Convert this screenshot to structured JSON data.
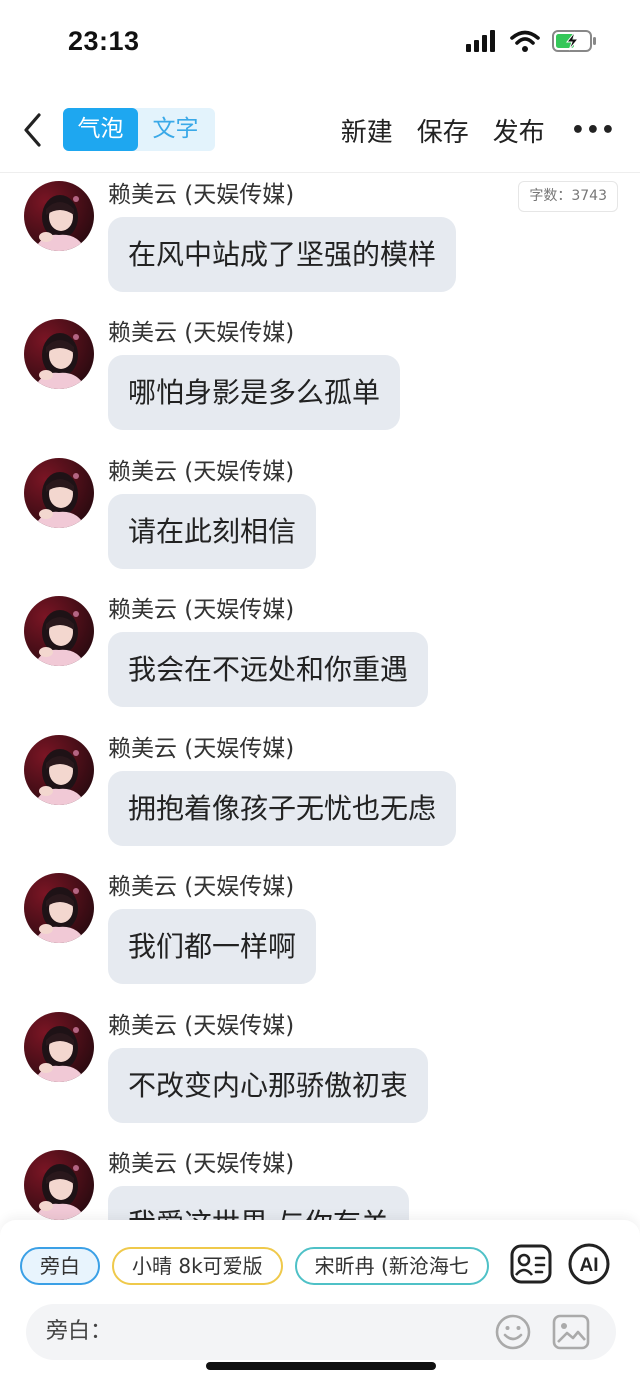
{
  "status_bar": {
    "time": "23:13",
    "icons": [
      "signal-icon",
      "wifi-icon",
      "battery-charging-icon"
    ]
  },
  "nav": {
    "back_icon": "chevron-left-icon",
    "segment_tabs": [
      {
        "label": "气泡",
        "active": true
      },
      {
        "label": "文字",
        "active": false
      }
    ],
    "actions": [
      "新建",
      "保存",
      "发布"
    ],
    "more_label": "•••"
  },
  "chat": {
    "word_count": "字数：3743",
    "messages": [
      {
        "sender": "赖美云 (天娱传媒)",
        "text": "在风中站成了坚强的模样"
      },
      {
        "sender": "赖美云 (天娱传媒)",
        "text": "哪怕身影是多么孤单"
      },
      {
        "sender": "赖美云 (天娱传媒)",
        "text": "请在此刻相信"
      },
      {
        "sender": "赖美云 (天娱传媒)",
        "text": "我会在不远处和你重遇"
      },
      {
        "sender": "赖美云 (天娱传媒)",
        "text": "拥抱着像孩子无忧也无虑"
      },
      {
        "sender": "赖美云 (天娱传媒)",
        "text": "我们都一样啊"
      },
      {
        "sender": "赖美云 (天娱传媒)",
        "text": "不改变内心那骄傲初衷"
      },
      {
        "sender": "赖美云 (天娱传媒)",
        "text": "我爱这世界 与你有关"
      }
    ]
  },
  "bottom": {
    "role_chips": [
      "旁白",
      "小晴 8k可爱版",
      "宋昕冉 (新沧海七"
    ],
    "profile_icon": "contact-card-icon",
    "ai_label": "AI",
    "input_label": "旁白：",
    "input_value": "",
    "emoji_icon": "smiley-icon",
    "image_icon": "image-icon"
  },
  "colors": {
    "accent": "#1ea7f0",
    "bubble": "#e6eaf0",
    "segment_bg": "#e3f3fc"
  }
}
